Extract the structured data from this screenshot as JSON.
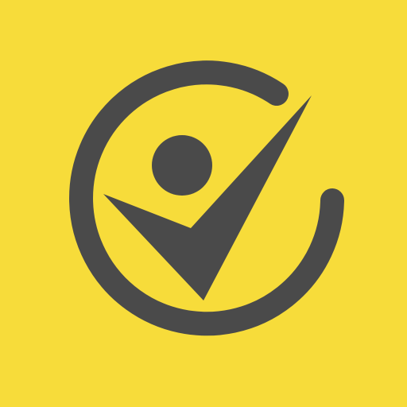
{
  "app_icon": {
    "background_color": "#F7DC3A",
    "glyph_color": "#4A4A4A",
    "icon_name": "person-check-circle-icon"
  }
}
